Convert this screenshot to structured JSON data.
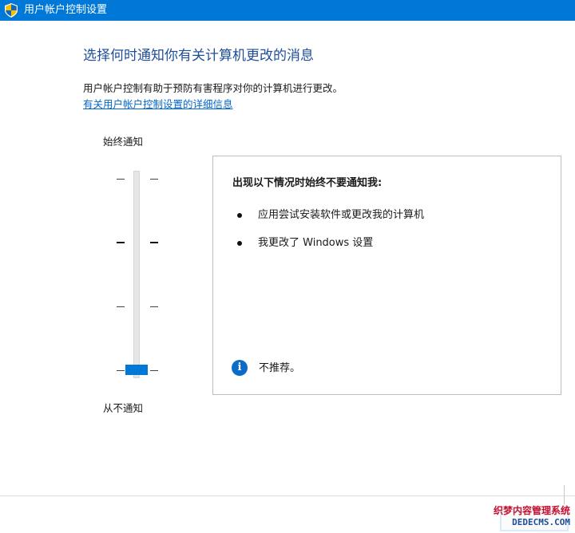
{
  "window": {
    "title": "用户帐户控制设置",
    "shield_icon": "uac-shield-icon"
  },
  "main": {
    "heading": "选择何时通知你有关计算机更改的消息",
    "description": "用户帐户控制有助于预防有害程序对你的计算机进行更改。",
    "details_link": "有关用户帐户控制设置的详细信息"
  },
  "slider": {
    "top_label": "始终通知",
    "bottom_label": "从不通知",
    "levels": 4,
    "selected_level": 1
  },
  "panel": {
    "title": "出现以下情况时始终不要通知我:",
    "items": [
      "应用尝试安装软件或更改我的计算机",
      "我更改了 Windows 设置"
    ],
    "info_text": "不推荐。",
    "info_icon": "info-icon"
  },
  "watermark": {
    "line1": "织梦内容管理系统",
    "line2": "DEDECMS.COM"
  },
  "colors": {
    "accent": "#0078d7",
    "heading": "#1f4e99",
    "link": "#0066cc"
  }
}
